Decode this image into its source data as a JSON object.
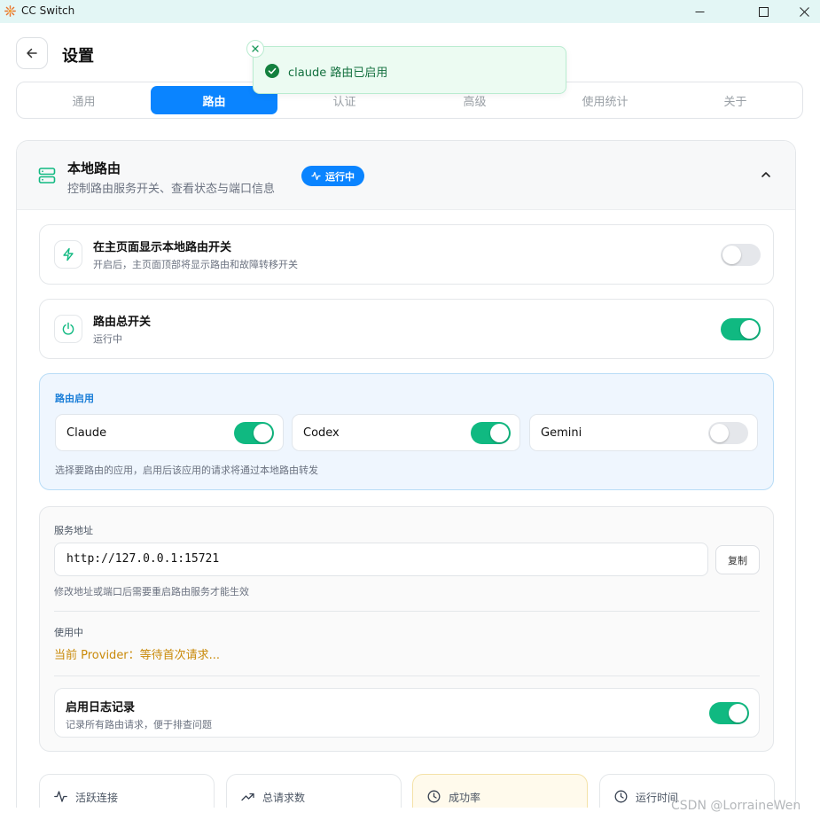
{
  "window": {
    "title": "CC Switch"
  },
  "header": {
    "title": "设置"
  },
  "toast": {
    "message": "claude 路由已启用"
  },
  "tabs": [
    {
      "label": "通用",
      "active": false
    },
    {
      "label": "路由",
      "active": true
    },
    {
      "label": "认证",
      "active": false
    },
    {
      "label": "高级",
      "active": false
    },
    {
      "label": "使用统计",
      "active": false
    },
    {
      "label": "关于",
      "active": false
    }
  ],
  "local_router": {
    "title": "本地路由",
    "subtitle": "控制路由服务开关、查看状态与端口信息",
    "status_badge": "运行中",
    "show_switch": {
      "title": "在主页面显示本地路由开关",
      "subtitle": "开启后，主页面顶部将显示路由和故障转移开关",
      "enabled": false
    },
    "master_switch": {
      "title": "路由总开关",
      "subtitle": "运行中",
      "enabled": true
    },
    "routing": {
      "label": "路由启用",
      "apps": [
        {
          "name": "Claude",
          "enabled": true
        },
        {
          "name": "Codex",
          "enabled": true
        },
        {
          "name": "Gemini",
          "enabled": false
        }
      ],
      "hint": "选择要路由的应用，启用后该应用的请求将通过本地路由转发"
    },
    "service": {
      "address_label": "服务地址",
      "address_value": "http://127.0.0.1:15721",
      "copy_label": "复制",
      "hint": "修改地址或端口后需要重启路由服务才能生效",
      "in_use_label": "使用中",
      "current_provider": "当前 Provider：等待首次请求...",
      "logging": {
        "title": "启用日志记录",
        "subtitle": "记录所有路由请求，便于排查问题",
        "enabled": true
      }
    },
    "stats": [
      {
        "label": "活跃连接",
        "icon": "activity-icon"
      },
      {
        "label": "总请求数",
        "icon": "trending-up-icon"
      },
      {
        "label": "成功率",
        "icon": "clock-icon"
      },
      {
        "label": "运行时间",
        "icon": "clock-icon"
      }
    ]
  },
  "watermark": "CSDN @LorraineWen",
  "colors": {
    "accent": "#0a84ff",
    "toggle_on": "#10b981",
    "provider_text": "#c98a0a"
  }
}
